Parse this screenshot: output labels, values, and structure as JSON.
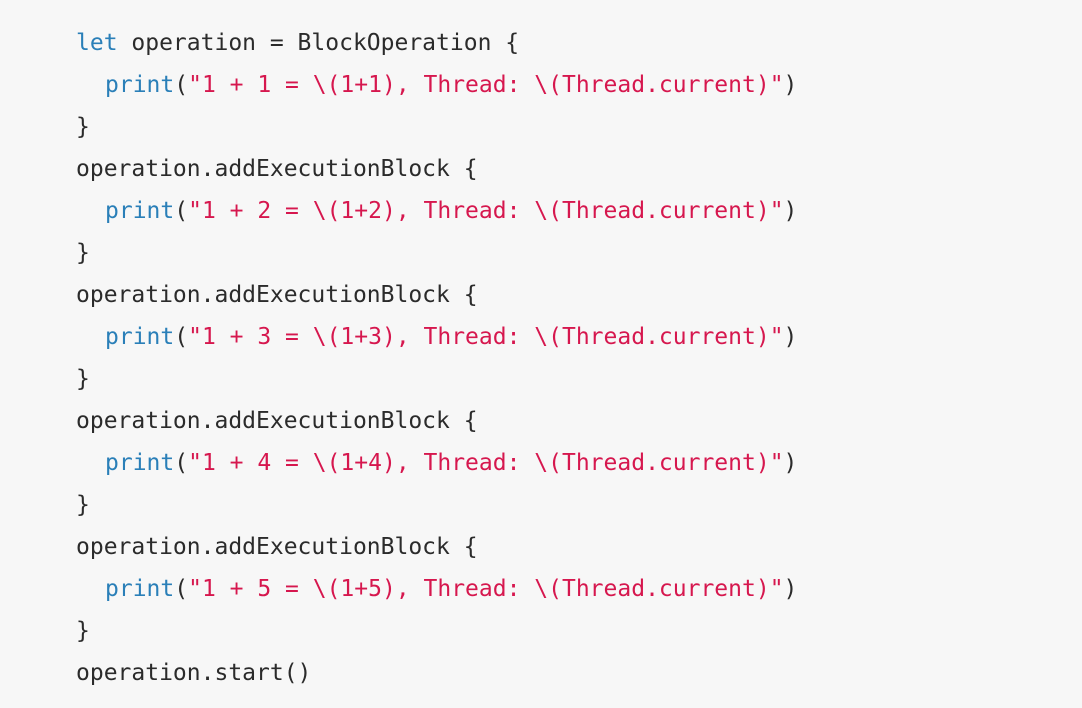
{
  "code": {
    "line1": {
      "keyword": "let",
      "rest": " operation = BlockOperation {"
    },
    "line2": {
      "fn": "print",
      "open": "(",
      "string": "\"1 + 1 = \\(1+1), Thread: \\(Thread.current)\"",
      "close": ")"
    },
    "line3": {
      "text": "}"
    },
    "line4": {
      "text": "operation.addExecutionBlock {"
    },
    "line5": {
      "fn": "print",
      "open": "(",
      "string": "\"1 + 2 = \\(1+2), Thread: \\(Thread.current)\"",
      "close": ")"
    },
    "line6": {
      "text": "}"
    },
    "line7": {
      "text": "operation.addExecutionBlock {"
    },
    "line8": {
      "fn": "print",
      "open": "(",
      "string": "\"1 + 3 = \\(1+3), Thread: \\(Thread.current)\"",
      "close": ")"
    },
    "line9": {
      "text": "}"
    },
    "line10": {
      "text": "operation.addExecutionBlock {"
    },
    "line11": {
      "fn": "print",
      "open": "(",
      "string": "\"1 + 4 = \\(1+4), Thread: \\(Thread.current)\"",
      "close": ")"
    },
    "line12": {
      "text": "}"
    },
    "line13": {
      "text": "operation.addExecutionBlock {"
    },
    "line14": {
      "fn": "print",
      "open": "(",
      "string": "\"1 + 5 = \\(1+5), Thread: \\(Thread.current)\"",
      "close": ")"
    },
    "line15": {
      "text": "}"
    },
    "line16": {
      "text": "operation.start()"
    }
  },
  "colors": {
    "background": "#f7f7f7",
    "keyword": "#2a7fb8",
    "string": "#d6174e",
    "plain": "#2b2b2b"
  }
}
